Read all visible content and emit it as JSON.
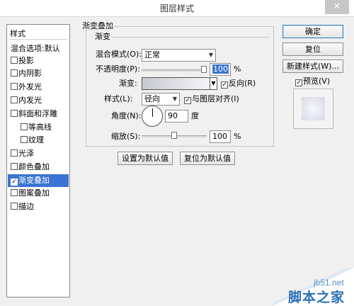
{
  "window": {
    "title": "图层样式",
    "close_glyph": "✕"
  },
  "styles_panel": {
    "header": "样式",
    "items": [
      {
        "label": "混合选项:默认",
        "checkbox": false,
        "checked": false,
        "selected": false
      },
      {
        "label": "投影",
        "checkbox": true,
        "checked": false,
        "selected": false
      },
      {
        "label": "内阴影",
        "checkbox": true,
        "checked": false,
        "selected": false
      },
      {
        "label": "外发光",
        "checkbox": true,
        "checked": false,
        "selected": false
      },
      {
        "label": "内发光",
        "checkbox": true,
        "checked": false,
        "selected": false
      },
      {
        "label": "斜面和浮雕",
        "checkbox": true,
        "checked": false,
        "selected": false
      },
      {
        "label": "等高线",
        "checkbox": true,
        "checked": false,
        "selected": false
      },
      {
        "label": "纹理",
        "checkbox": true,
        "checked": false,
        "selected": false
      },
      {
        "label": "光泽",
        "checkbox": true,
        "checked": false,
        "selected": false
      },
      {
        "label": "颜色叠加",
        "checkbox": true,
        "checked": false,
        "selected": false
      },
      {
        "label": "渐变叠加",
        "checkbox": true,
        "checked": true,
        "selected": true
      },
      {
        "label": "图案叠加",
        "checkbox": true,
        "checked": false,
        "selected": false
      },
      {
        "label": "描边",
        "checkbox": true,
        "checked": false,
        "selected": false
      }
    ]
  },
  "gradient_overlay": {
    "section_title": "渐变叠加",
    "group_title": "渐变",
    "blend_mode": {
      "label": "混合模式(O):",
      "value": "正常"
    },
    "opacity": {
      "label": "不透明度(P):",
      "value": "100",
      "unit": "%",
      "fraction": 1.0
    },
    "gradient": {
      "label": "渐变:",
      "reverse_label": "反向(R)",
      "reverse_checked": true
    },
    "style": {
      "label": "样式(L):",
      "value": "径向",
      "align_label": "与图层对齐(I)",
      "align_checked": true
    },
    "angle": {
      "label": "角度(N):",
      "value": "90",
      "unit": "度"
    },
    "scale": {
      "label": "缩放(S):",
      "value": "100",
      "unit": "%",
      "fraction": 0.5
    },
    "buttons": {
      "set_default": "设置为默认值",
      "reset_default": "复位为默认值"
    }
  },
  "right_panel": {
    "ok": "确定",
    "reset": "复位",
    "new_style": "新建样式(W)...",
    "preview_label": "预览(V)",
    "preview_checked": true
  },
  "watermark": {
    "line1": "jb51.net",
    "line2": "脚本之家"
  },
  "colors": {
    "selection": "#3b74d2",
    "dialog_bg": "#f0f0f0",
    "ok_border": "#3c7fb1"
  }
}
